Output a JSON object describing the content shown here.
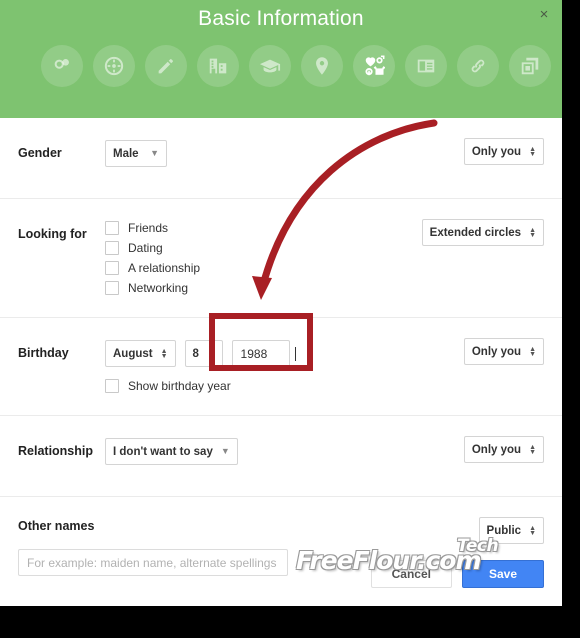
{
  "dialog": {
    "title": "Basic Information",
    "close_label": "×"
  },
  "tabs": [
    {
      "name": "circles",
      "label": "Circles"
    },
    {
      "name": "sports",
      "label": "Sports"
    },
    {
      "name": "edit",
      "label": "Story"
    },
    {
      "name": "work",
      "label": "Work"
    },
    {
      "name": "education",
      "label": "Education"
    },
    {
      "name": "places",
      "label": "Places"
    },
    {
      "name": "basic-info",
      "label": "Basic Information"
    },
    {
      "name": "contact",
      "label": "Contact Information"
    },
    {
      "name": "links",
      "label": "Links"
    },
    {
      "name": "apps",
      "label": "Apps"
    }
  ],
  "active_tab_index": 6,
  "form": {
    "gender": {
      "label": "Gender",
      "value": "Male",
      "privacy": "Only you"
    },
    "looking_for": {
      "label": "Looking for",
      "privacy": "Extended circles",
      "options": [
        {
          "label": "Friends",
          "checked": false
        },
        {
          "label": "Dating",
          "checked": false
        },
        {
          "label": "A relationship",
          "checked": false
        },
        {
          "label": "Networking",
          "checked": false
        }
      ]
    },
    "birthday": {
      "label": "Birthday",
      "month": "August",
      "day": "8",
      "year": "1988",
      "show_year_label": "Show birthday year",
      "show_year_checked": false,
      "privacy": "Only you"
    },
    "relationship": {
      "label": "Relationship",
      "value": "I don't want to say",
      "privacy": "Only you"
    },
    "other_names": {
      "label": "Other names",
      "value": "",
      "placeholder": "For example: maiden name, alternate spellings",
      "privacy": "Public"
    }
  },
  "footer": {
    "cancel_label": "Cancel",
    "save_label": "Save"
  },
  "watermark": {
    "main": "FreeFlour.com",
    "sub": "Tech"
  },
  "colors": {
    "header_green": "#7ec370",
    "save_blue": "#4285f4",
    "annotation_red": "#a81f24"
  }
}
